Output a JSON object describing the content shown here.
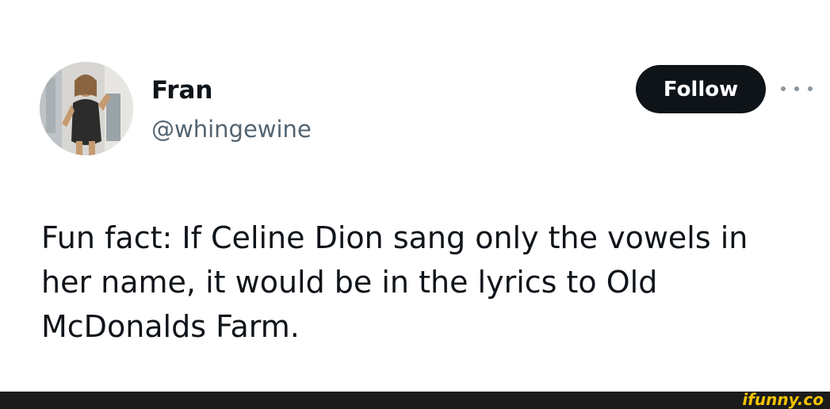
{
  "author": {
    "display_name": "Fran",
    "handle": "@whingewine",
    "avatar": "avatar-photo"
  },
  "actions": {
    "follow_label": "Follow",
    "more_icon": "more-horizontal-icon"
  },
  "tweet": {
    "text": "Fun fact: If Celine Dion sang only the vowels in her name, it would be in the lyrics to Old McDonalds Farm."
  },
  "footer": {
    "watermark": "ifunny.co",
    "watermark_color": "#f3c300",
    "bar_color": "#1b1b1b"
  },
  "colors": {
    "text_primary": "#0f1419",
    "text_secondary": "#536471",
    "button_bg": "#0f1419",
    "button_text": "#ffffff"
  }
}
